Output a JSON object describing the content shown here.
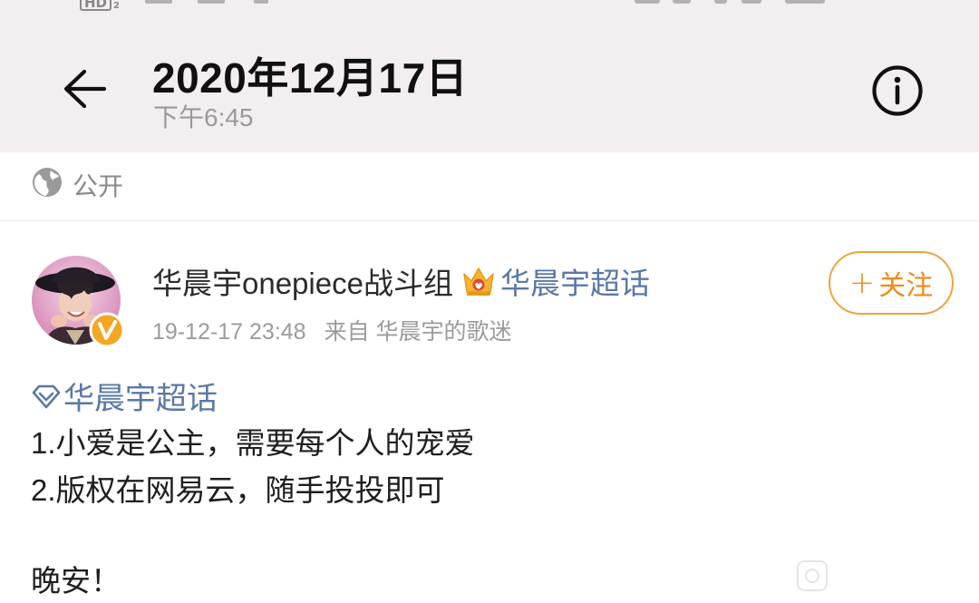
{
  "status_bar": {
    "hd_label": "HD",
    "hd_sub": "2"
  },
  "header": {
    "title": "2020年12月17日",
    "subtitle": "下午6:45",
    "back_icon": "arrow-left-icon",
    "info_icon": "info-circle-icon"
  },
  "visibility": {
    "icon": "globe-icon",
    "label": "公开"
  },
  "post": {
    "author": "华晨宇onepiece战斗组",
    "badge_icon": "crown-icon",
    "super_topic_link": "华晨宇超话",
    "timestamp": "19-12-17 23:48",
    "source": "来自 华晨宇的歌迷",
    "follow_label": "关注",
    "follow_plus": "+",
    "verified_icon": "verified-v-icon",
    "topic_tag": "华晨宇超话",
    "lines": [
      "1.小爱是公主，需要每个人的宠爱",
      "2.版权在网易云，随手投投即可",
      "晚安！"
    ]
  },
  "colors": {
    "header_bg": "#f3eff0",
    "link": "#5a78a6",
    "follow_orange": "#f08a1a",
    "muted": "#9b9b9b"
  }
}
